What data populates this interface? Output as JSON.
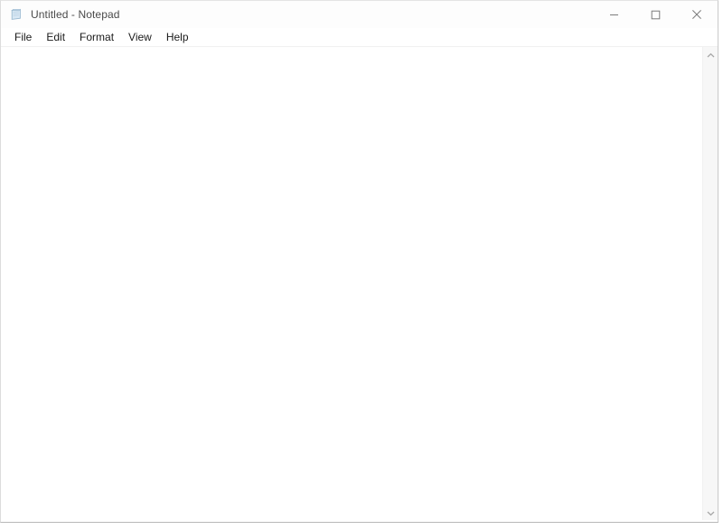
{
  "window": {
    "title": "Untitled - Notepad",
    "icon": "notepad-icon",
    "controls": {
      "minimize_label": "Minimize",
      "maximize_label": "Maximize",
      "close_label": "Close"
    }
  },
  "menubar": {
    "items": [
      {
        "label": "File",
        "name": "menu-file"
      },
      {
        "label": "Edit",
        "name": "menu-edit"
      },
      {
        "label": "Format",
        "name": "menu-format"
      },
      {
        "label": "View",
        "name": "menu-view"
      },
      {
        "label": "Help",
        "name": "menu-help"
      }
    ]
  },
  "editor": {
    "value": "",
    "placeholder": ""
  },
  "scrollbar": {
    "up_arrow": "chevron-up-icon",
    "down_arrow": "chevron-down-icon"
  },
  "colors": {
    "window_background": "#ffffff",
    "titlebar_background": "#fdfdfd",
    "title_text": "#4a4a4a",
    "menu_text": "#1a1a1a",
    "scrollbar_track": "#f7f7f7",
    "scrollbar_arrow": "#a0a0a0",
    "border": "#c9c9c9",
    "icon_accent": "#7ea7c9"
  }
}
